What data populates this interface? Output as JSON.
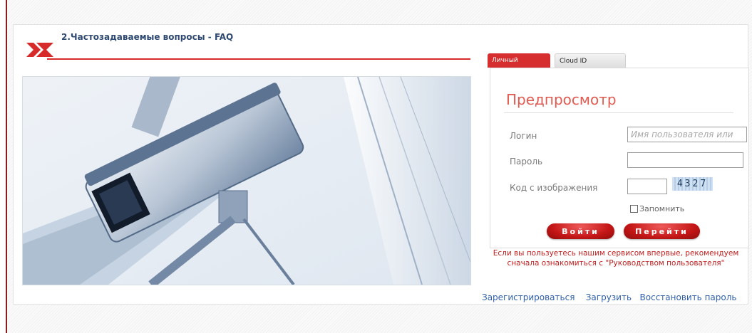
{
  "header": {
    "faq_link": "2.Частозадаваемые вопросы - FAQ"
  },
  "colors": {
    "accent_red": "#d72a2a",
    "link_blue": "#2f5faa",
    "title_red": "#e25a4f"
  },
  "tabs": [
    {
      "label": "Личный кабинет",
      "active": true
    },
    {
      "label": "Cloud ID",
      "active": false
    }
  ],
  "login": {
    "title": "Предпросмотр",
    "username_label": "Логин",
    "username_placeholder": "Имя пользователя или",
    "password_label": "Пароль",
    "captcha_label": "Код с изображения",
    "captcha_code": "4327",
    "remember_label": "Запомнить",
    "login_button": "Войти",
    "go_button": "Перейти",
    "notice": "Если вы пользуетесь нашим сервисом впервые, рекомендуем сначала ознакомиться с \"Руководством пользователя\""
  },
  "footer_links": {
    "register": "Зарегистрироваться",
    "download": "Загрузить",
    "restore": "Восстановить пароль"
  },
  "icons": {
    "logo": "brand-logo-icon",
    "photo": "security-camera-image"
  }
}
